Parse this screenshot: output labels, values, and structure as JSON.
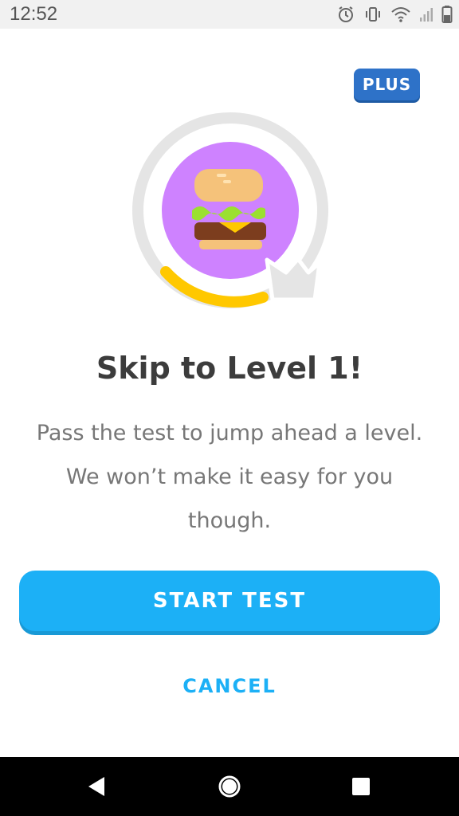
{
  "status_bar": {
    "time": "12:52",
    "icons": [
      "alarm-icon",
      "vibrate-icon",
      "wifi-icon",
      "signal-icon",
      "battery-icon"
    ]
  },
  "badge": {
    "label": "PLUS"
  },
  "skill": {
    "icon": "hamburger-icon",
    "progress_fraction": 0.2,
    "crown_icon": "crown-icon",
    "colors": {
      "circle": "#ce82ff",
      "progress": "#ffc800",
      "ring": "#e5e5e5"
    }
  },
  "main": {
    "title": "Skip to Level 1!",
    "description": "Pass the test to jump ahead a level. We won’t make it easy for you though."
  },
  "actions": {
    "start_label": "START TEST",
    "cancel_label": "CANCEL"
  },
  "colors": {
    "accent": "#1cb0f6",
    "badge": "#2e72c8"
  },
  "nav_bar": {
    "icons": [
      "back-icon",
      "home-icon",
      "recents-icon"
    ]
  }
}
